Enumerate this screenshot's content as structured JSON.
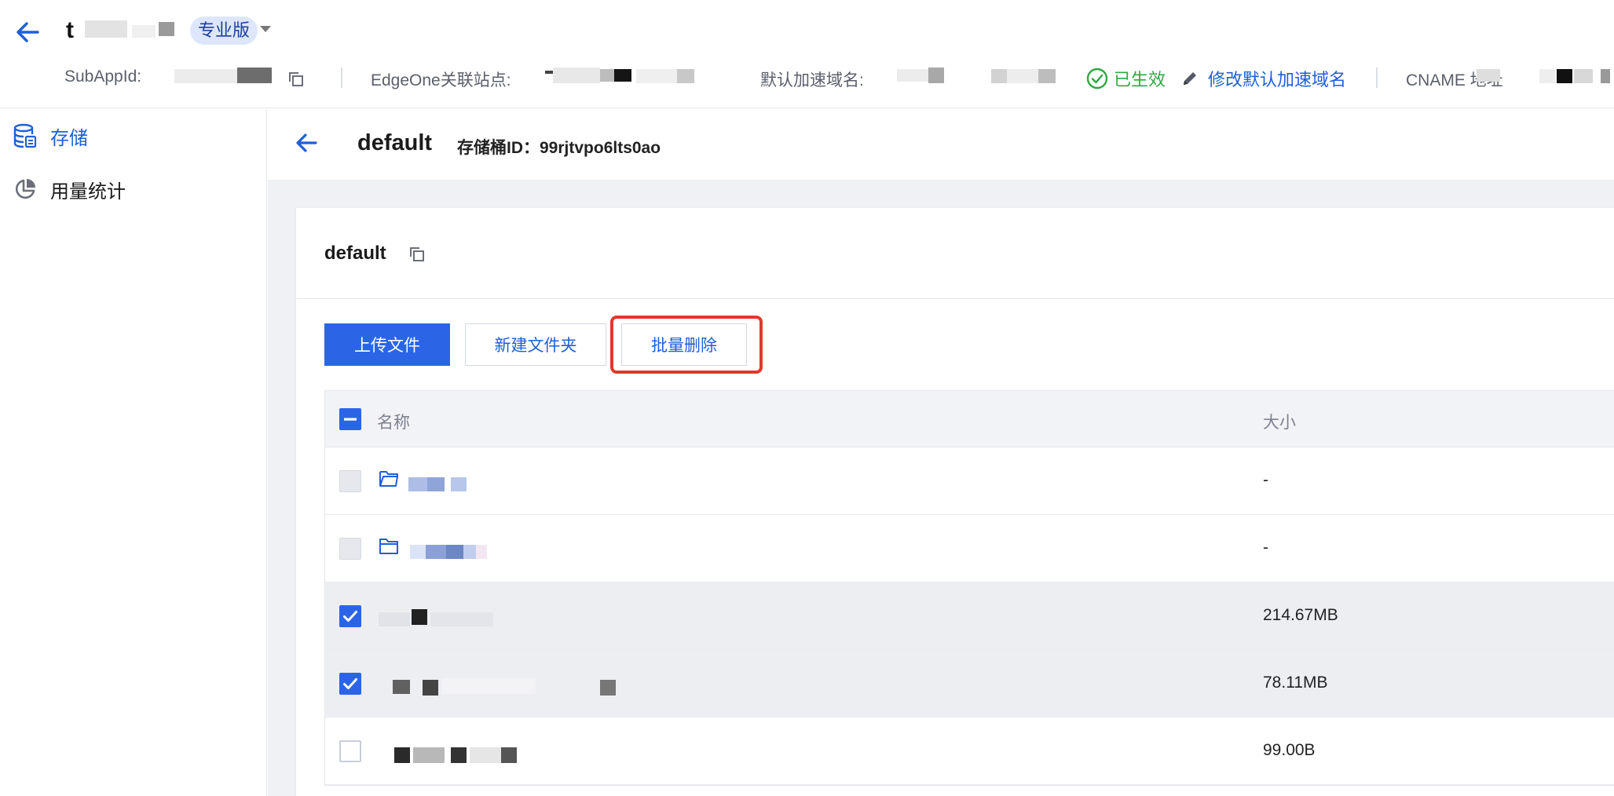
{
  "header": {
    "app_name": "t",
    "plan_badge": "专业版",
    "subappid_label": "SubAppId:",
    "edgeone_label": "EdgeOne关联站点:",
    "default_domain_label": "默认加速域名:",
    "status_text": "已生效",
    "edit_domain_link": "修改默认加速域名",
    "cname_label": "CNAME 地址"
  },
  "sidebar": {
    "items": [
      {
        "label": "存储",
        "icon": "database-icon",
        "active": true
      },
      {
        "label": "用量统计",
        "icon": "pie-chart-icon",
        "active": false
      }
    ]
  },
  "bucket": {
    "title": "default",
    "id_text": "存储桶ID：99rjtvpo6lts0ao"
  },
  "panel": {
    "title": "default"
  },
  "toolbar": {
    "upload_label": "上传文件",
    "new_folder_label": "新建文件夹",
    "batch_delete_label": "批量删除"
  },
  "table": {
    "columns": {
      "name": "名称",
      "size": "大小"
    },
    "rows": [
      {
        "type": "folder",
        "size": "-",
        "checked": false,
        "disabled": true
      },
      {
        "type": "folder",
        "size": "-",
        "checked": false,
        "disabled": true
      },
      {
        "type": "file",
        "size": "214.67MB",
        "checked": true,
        "disabled": false
      },
      {
        "type": "file",
        "size": "78.11MB",
        "checked": true,
        "disabled": false
      },
      {
        "type": "file",
        "size": "99.00B",
        "checked": false,
        "disabled": false
      }
    ]
  },
  "colors": {
    "accent": "#2b65e6",
    "link": "#1e5fd7",
    "success": "#2fa843",
    "highlight": "#e0392b"
  }
}
